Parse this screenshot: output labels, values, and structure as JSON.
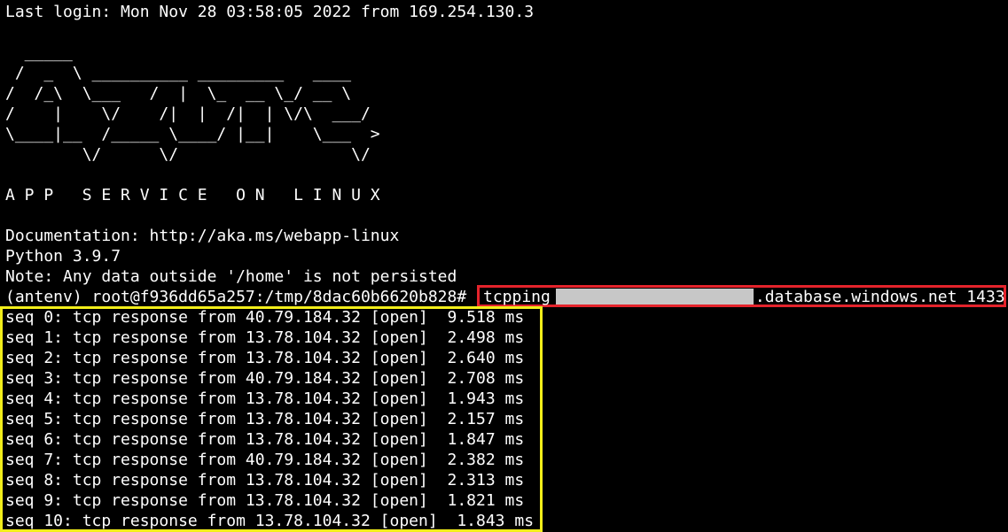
{
  "terminal": {
    "last_login": "Last login: Mon Nov 28 03:58:05 2022 from 169.254.130.3",
    "banner_art": "  _____\n /  _  \\ __________ _________   ____\n/  /_\\  \\___   /  |  \\_  __ \\_/ __ \\\n/    |    \\/    /|  |  /|  | \\/\\  ___/\n\\____|__  /_____ \\____/ |__|    \\___  >\n        \\/      \\/                  \\/",
    "service_title": "A P P   S E R V I C E   O N   L I N U X",
    "documentation": "Documentation: http://aka.ms/webapp-linux",
    "python_version": "Python 3.9.7",
    "note": "Note: Any data outside '/home' is not persisted",
    "prompt": "(antenv) root@f936dd65a257:/tmp/8dac60b6620b828#",
    "command": {
      "name": "tcpping",
      "host_suffix": ".database.windows.net",
      "port": "1433"
    },
    "results": [
      "seq 0: tcp response from 40.79.184.32 [open]  9.518 ms",
      "seq 1: tcp response from 13.78.104.32 [open]  2.498 ms",
      "seq 2: tcp response from 13.78.104.32 [open]  2.640 ms",
      "seq 3: tcp response from 40.79.184.32 [open]  2.708 ms",
      "seq 4: tcp response from 13.78.104.32 [open]  1.943 ms",
      "seq 5: tcp response from 13.78.104.32 [open]  2.157 ms",
      "seq 6: tcp response from 13.78.104.32 [open]  1.847 ms",
      "seq 7: tcp response from 40.79.184.32 [open]  2.382 ms",
      "seq 8: tcp response from 13.78.104.32 [open]  2.313 ms",
      "seq 9: tcp response from 13.78.104.32 [open]  1.821 ms",
      "seq 10: tcp response from 13.78.104.32 [open]  1.843 ms"
    ]
  },
  "colors": {
    "background": "#000000",
    "text": "#ffffff",
    "command_highlight": "#e4232b",
    "results_highlight": "#f2ee1a",
    "redaction": "#c7c7c7"
  }
}
